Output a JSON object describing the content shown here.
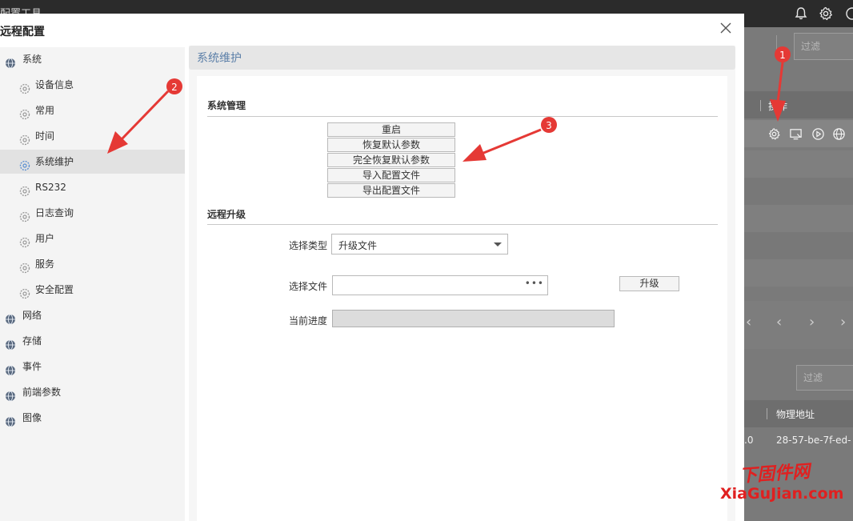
{
  "app": {
    "title": "配置工具"
  },
  "topbar_icons": [
    "bell-icon",
    "gear-icon",
    "info-icon"
  ],
  "background": {
    "filter_top": "过滤",
    "filter_bottom": "过滤",
    "column_operate": "操作",
    "column_mac": "物理地址",
    "cell_fragment": ".0",
    "cell_mac": "28-57-be-7f-ed-"
  },
  "dialog": {
    "title": "远程配置"
  },
  "sidebar": {
    "items": [
      {
        "label": "系统",
        "level": 0
      },
      {
        "label": "设备信息",
        "level": 1
      },
      {
        "label": "常用",
        "level": 1
      },
      {
        "label": "时间",
        "level": 1
      },
      {
        "label": "系统维护",
        "level": 1,
        "active": true
      },
      {
        "label": "RS232",
        "level": 1
      },
      {
        "label": "日志查询",
        "level": 1
      },
      {
        "label": "用户",
        "level": 1
      },
      {
        "label": "服务",
        "level": 1
      },
      {
        "label": "安全配置",
        "level": 1
      },
      {
        "label": "网络",
        "level": 0
      },
      {
        "label": "存储",
        "level": 0
      },
      {
        "label": "事件",
        "level": 0
      },
      {
        "label": "前端参数",
        "level": 0
      },
      {
        "label": "图像",
        "level": 0
      }
    ]
  },
  "content": {
    "header": "系统维护",
    "system_management": {
      "title": "系统管理",
      "buttons": [
        "重启",
        "恢复默认参数",
        "完全恢复默认参数",
        "导入配置文件",
        "导出配置文件"
      ]
    },
    "remote_upgrade": {
      "title": "远程升级",
      "type_label": "选择类型",
      "type_value": "升级文件",
      "file_label": "选择文件",
      "file_value": "",
      "file_browse": "•••",
      "upgrade_button": "升级",
      "progress_label": "当前进度",
      "progress_value": 0
    }
  },
  "annotations": {
    "markers": [
      "1",
      "2",
      "3"
    ],
    "accent_color": "#e53935"
  },
  "watermark": {
    "line1": "下固件网",
    "line2": "XiaGuJian.com"
  }
}
